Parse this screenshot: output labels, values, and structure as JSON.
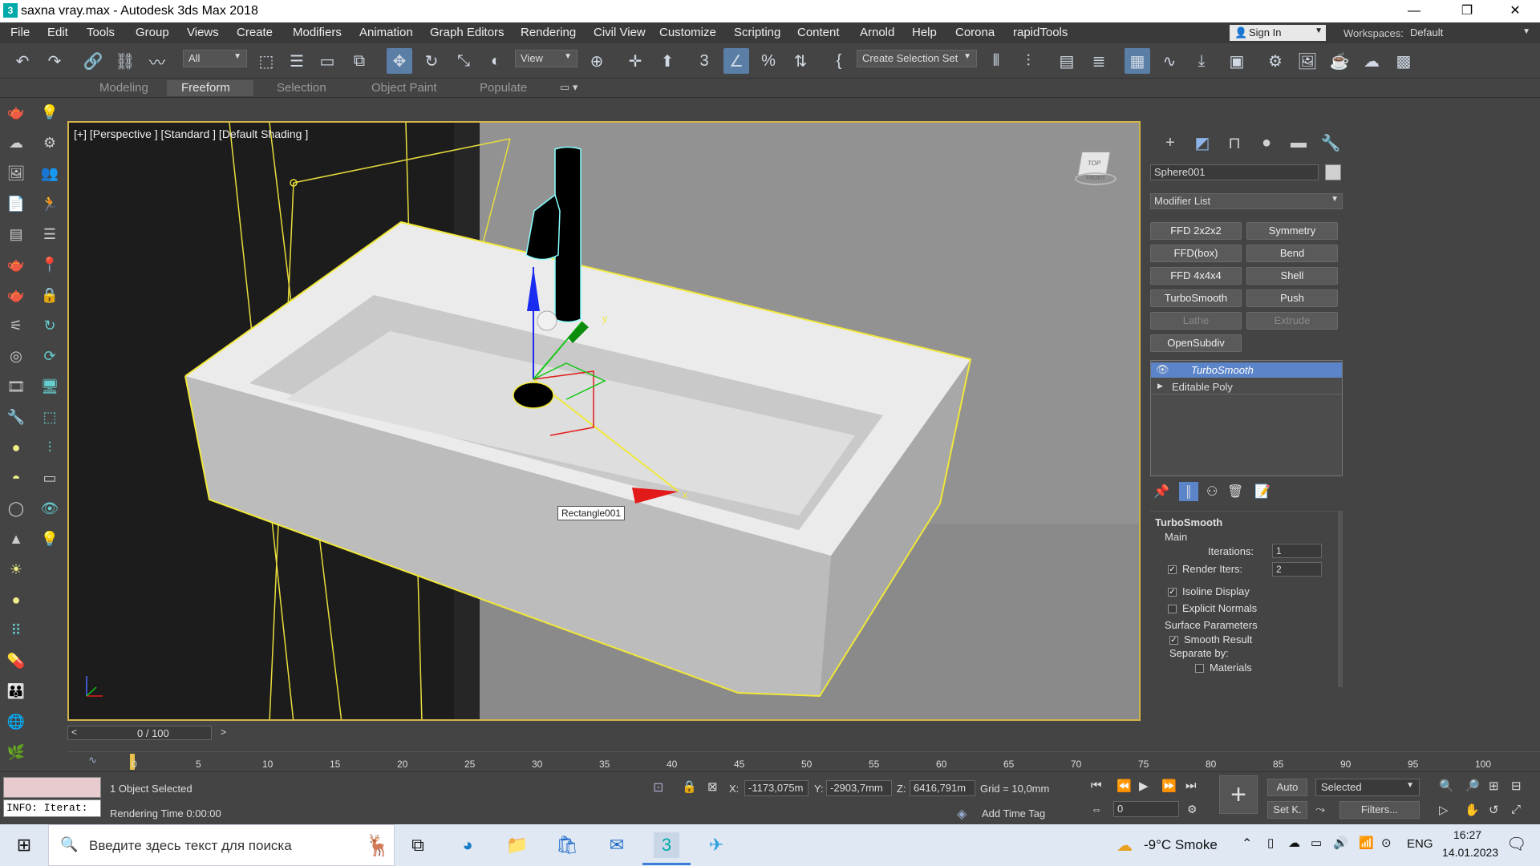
{
  "window": {
    "title": "saxna vray.max - Autodesk 3ds Max 2018",
    "app_icon": "3",
    "min_glyph": "—",
    "max_glyph": "❐",
    "close_glyph": "✕"
  },
  "menu": [
    "File",
    "Edit",
    "Tools",
    "Group",
    "Views",
    "Create",
    "Modifiers",
    "Animation",
    "Graph Editors",
    "Rendering",
    "Civil View",
    "Customize",
    "Scripting",
    "Content",
    "Arnold",
    "Help",
    "Corona",
    "rapidTools"
  ],
  "account": {
    "sign_in": "Sign In",
    "workspaces_label": "Workspaces:",
    "workspace": "Default"
  },
  "toolbar": {
    "filter": "All",
    "ref_coord": "View",
    "selection_set": "Create Selection Set"
  },
  "ribbon_tabs": [
    "Modeling",
    "Freeform",
    "Selection",
    "Object Paint",
    "Populate"
  ],
  "viewport": {
    "label": "[+] [Perspective ] [Standard ] [Default Shading ]",
    "tag": "Rectangle001",
    "gizmo_y": "y",
    "gizmo_x": "x",
    "cube_top": "TOP",
    "cube_front": "FRONT"
  },
  "command_panel": {
    "object_name": "Sphere001",
    "modifier_list": "Modifier List",
    "modifier_buttons": [
      {
        "label": "FFD 2x2x2",
        "dim": false
      },
      {
        "label": "Symmetry",
        "dim": false
      },
      {
        "label": "FFD(box)",
        "dim": false
      },
      {
        "label": "Bend",
        "dim": false
      },
      {
        "label": "FFD 4x4x4",
        "dim": false
      },
      {
        "label": "Shell",
        "dim": false
      },
      {
        "label": "TurboSmooth",
        "dim": false
      },
      {
        "label": "Push",
        "dim": false
      },
      {
        "label": "Lathe",
        "dim": true
      },
      {
        "label": "Extrude",
        "dim": true
      },
      {
        "label": "OpenSubdiv",
        "dim": false
      }
    ],
    "stack": [
      {
        "label": "TurboSmooth",
        "selected": true
      },
      {
        "label": "Editable Poly",
        "selected": false
      }
    ],
    "rollout": {
      "title": "TurboSmooth",
      "main": "Main",
      "iterations_label": "Iterations:",
      "iterations": "1",
      "render_iters_label": "Render Iters:",
      "render_iters": "2",
      "isoline": "Isoline Display",
      "explicit": "Explicit Normals",
      "surface": "Surface Parameters",
      "smooth": "Smooth Result",
      "separate": "Separate by:",
      "materials": "Materials"
    }
  },
  "timeline": {
    "frame": "0 / 100",
    "ticks": [
      "0",
      "5",
      "10",
      "15",
      "20",
      "25",
      "30",
      "35",
      "40",
      "45",
      "50",
      "55",
      "60",
      "65",
      "70",
      "75",
      "80",
      "85",
      "90",
      "95",
      "100"
    ]
  },
  "status": {
    "info": "INFO: Iterat:",
    "selected": "1 Object Selected",
    "render_time": "Rendering Time  0:00:00",
    "x_label": "X:",
    "x": "-1173,075m",
    "y_label": "Y:",
    "y": "-2903,7mm",
    "z_label": "Z:",
    "z": "6416,791m",
    "grid": "Grid = 10,0mm",
    "add_time_tag": "Add Time Tag",
    "auto": "Auto",
    "set_key": "Set K.",
    "key_mode": "Selected",
    "filters": "Filters...",
    "frame_field": "0"
  },
  "taskbar": {
    "search": "Введите здесь текст для поиска",
    "weather": "-9°C  Smoke",
    "lang": "ENG",
    "time": "16:27",
    "date": "14.01.2023"
  }
}
